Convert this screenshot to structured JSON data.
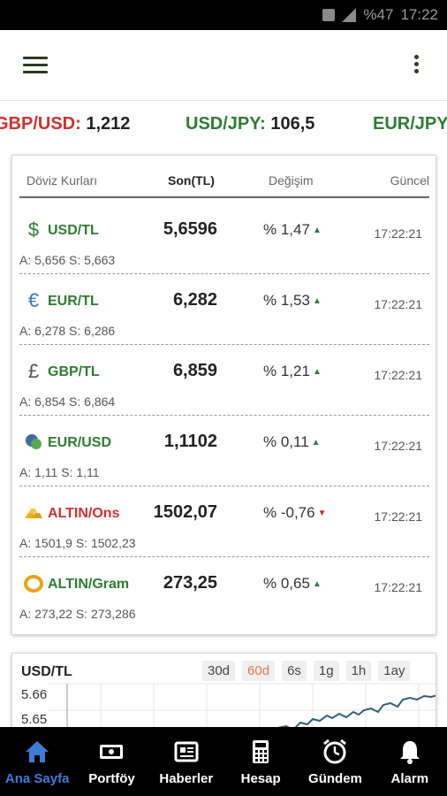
{
  "status_bar": {
    "battery": "%47",
    "time": "17:22"
  },
  "ticker": [
    {
      "pair": "GBP/USD:",
      "value": "1,212",
      "color": "#d32f2f"
    },
    {
      "pair": "USD/JPY:",
      "value": "106,5",
      "color": "#2e7d32"
    },
    {
      "pair": "EUR/JPY",
      "value": "",
      "color": "#2e7d32"
    }
  ],
  "table": {
    "headers": {
      "name": "Döviz Kurları",
      "last": "Son(TL)",
      "change": "Değişim",
      "updated": "Güncel"
    },
    "rows": [
      {
        "icon": "dollar-icon",
        "symbol": "$",
        "name": "USD/TL",
        "name_color": "#2e7d32",
        "last": "5,6596",
        "change": "% 1,47",
        "direction": "up",
        "time": "17:22:21",
        "bid_ask": "A: 5,656  S: 5,663"
      },
      {
        "icon": "euro-icon",
        "symbol": "€",
        "name": "EUR/TL",
        "name_color": "#2e7d32",
        "last": "6,282",
        "change": "% 1,53",
        "direction": "up",
        "time": "17:22:21",
        "bid_ask": "A: 6,278  S: 6,286"
      },
      {
        "icon": "pound-icon",
        "symbol": "£",
        "name": "GBP/TL",
        "name_color": "#2e7d32",
        "last": "6,859",
        "change": "% 1,21",
        "direction": "up",
        "time": "17:22:21",
        "bid_ask": "A: 6,854  S: 6,864"
      },
      {
        "icon": "coins-icon",
        "symbol": "",
        "name": "EUR/USD",
        "name_color": "#2e7d32",
        "last": "1,1102",
        "change": "% 0,11",
        "direction": "up",
        "time": "17:22:21",
        "bid_ask": "A: 1,11  S: 1,11"
      },
      {
        "icon": "gold-bars-icon",
        "symbol": "",
        "name": "ALTIN/Ons",
        "name_color": "#d32f2f",
        "last": "1502,07",
        "change": "% -0,76",
        "direction": "down",
        "time": "17:22:21",
        "bid_ask": "A: 1501,9  S: 1502,23"
      },
      {
        "icon": "gold-ring-icon",
        "symbol": "",
        "name": "ALTIN/Gram",
        "name_color": "#2e7d32",
        "last": "273,25",
        "change": "% 0,65",
        "direction": "up",
        "time": "17:22:21",
        "bid_ask": "A: 273,22  S: 273,286"
      }
    ]
  },
  "chart": {
    "title": "USD/TL",
    "ranges": [
      "30d",
      "60d",
      "6s",
      "1g",
      "1h",
      "1ay"
    ],
    "active_range": "60d",
    "ytick_labels": [
      "5.66",
      "5.65"
    ]
  },
  "bottom_nav": [
    {
      "label": "Ana Sayfa",
      "icon": "home-icon",
      "active": true
    },
    {
      "label": "Portföy",
      "icon": "wallet-icon",
      "active": false
    },
    {
      "label": "Haberler",
      "icon": "newspaper-icon",
      "active": false
    },
    {
      "label": "Hesap",
      "icon": "calculator-icon",
      "active": false
    },
    {
      "label": "Gündem",
      "icon": "alarm-clock-icon",
      "active": false
    },
    {
      "label": "Alarm",
      "icon": "bell-icon",
      "active": false
    }
  ],
  "colors": {
    "up": "#2e7d32",
    "down": "#d32f2f",
    "accent": "#e07a4a",
    "nav_active": "#3d7bd6",
    "chart_line": "#2c5f7a"
  }
}
